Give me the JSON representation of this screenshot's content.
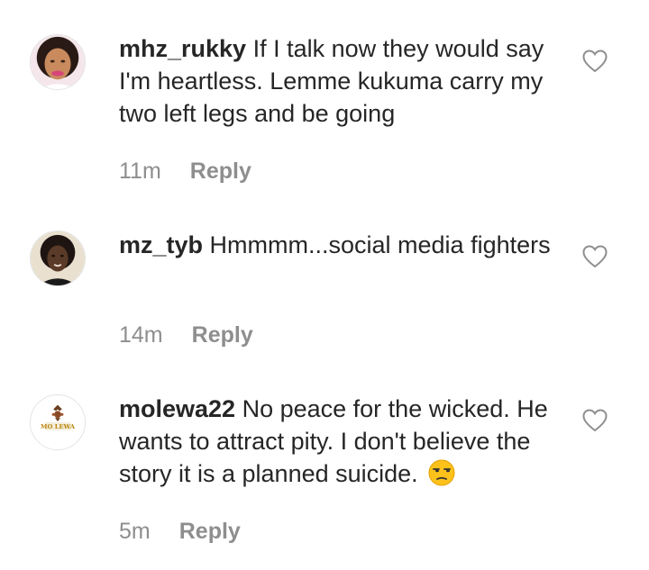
{
  "comments": [
    {
      "username": "mhz_rukky",
      "text": " If I talk now they would say I'm heartless. Lemme kukuma carry my two left legs and be going",
      "time": "11m",
      "reply_label": "Reply",
      "avatar_icon": "profile-photo-woman-pink-lips",
      "like_icon": "heart-outline-icon"
    },
    {
      "username": "mz_tyb",
      "text": " Hmmmm...social media fighters",
      "time": "14m",
      "reply_label": "Reply",
      "avatar_icon": "profile-photo-woman-dark",
      "like_icon": "heart-outline-icon"
    },
    {
      "username": "molewa22",
      "text": " No peace for the wicked. He wants to attract pity. I don't believe the story it is a planned suicide.",
      "time": "5m",
      "reply_label": "Reply",
      "avatar_icon": "molewa-logo",
      "avatar_logo_text": "MO LEWA",
      "emoji": "unamused-face-emoji",
      "like_icon": "heart-outline-icon"
    }
  ],
  "colors": {
    "text": "#262626",
    "meta": "#8e8e8e",
    "heart_stroke": "#8e8e8e"
  }
}
